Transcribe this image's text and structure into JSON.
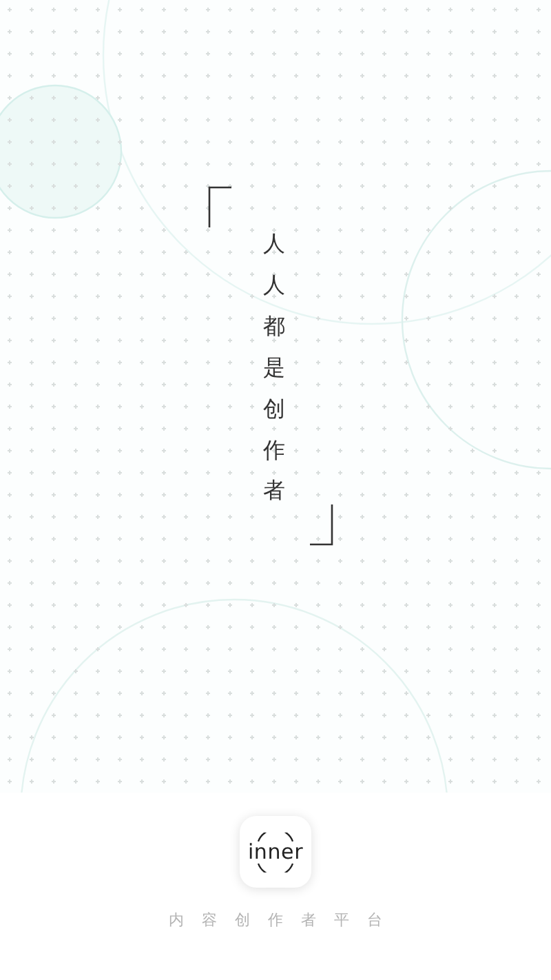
{
  "slogan": "人人都是创作者",
  "app_logo": {
    "name": "inner"
  },
  "tagline": "内容创作者平台"
}
